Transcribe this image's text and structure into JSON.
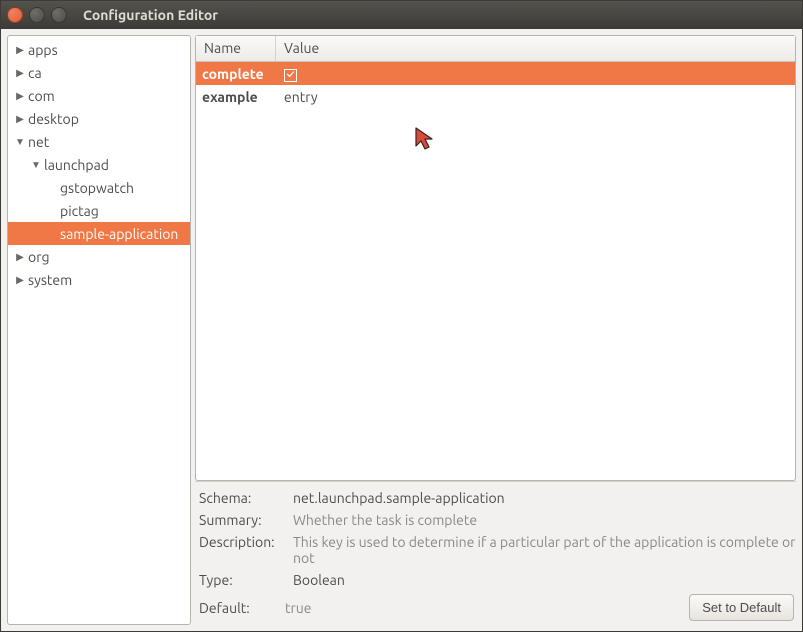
{
  "window": {
    "title": "Configuration Editor"
  },
  "tree": [
    {
      "label": "apps",
      "indent": 0,
      "arrow": "right",
      "selected": false
    },
    {
      "label": "ca",
      "indent": 0,
      "arrow": "right",
      "selected": false
    },
    {
      "label": "com",
      "indent": 0,
      "arrow": "right",
      "selected": false
    },
    {
      "label": "desktop",
      "indent": 0,
      "arrow": "right",
      "selected": false
    },
    {
      "label": "net",
      "indent": 0,
      "arrow": "down",
      "selected": false
    },
    {
      "label": "launchpad",
      "indent": 1,
      "arrow": "down",
      "selected": false
    },
    {
      "label": "gstopwatch",
      "indent": 2,
      "arrow": "none",
      "selected": false
    },
    {
      "label": "pictag",
      "indent": 2,
      "arrow": "none",
      "selected": false
    },
    {
      "label": "sample-application",
      "indent": 2,
      "arrow": "none",
      "selected": true
    },
    {
      "label": "org",
      "indent": 0,
      "arrow": "right",
      "selected": false
    },
    {
      "label": "system",
      "indent": 0,
      "arrow": "right",
      "selected": false
    }
  ],
  "columns": {
    "name": "Name",
    "value": "Value"
  },
  "rows": [
    {
      "name": "complete",
      "value_type": "checkbox",
      "value": "✓",
      "selected": true
    },
    {
      "name": "example",
      "value_type": "text",
      "value": "entry",
      "selected": false
    }
  ],
  "details": {
    "schema_label": "Schema:",
    "schema_value": "net.launchpad.sample-application",
    "summary_label": "Summary:",
    "summary_value": "Whether the task is complete",
    "description_label": "Description:",
    "description_value": "This key is used to determine if a particular part of the application is complete or not",
    "type_label": "Type:",
    "type_value": "Boolean",
    "default_label": "Default:",
    "default_value": "true",
    "button_label": "Set to Default"
  }
}
